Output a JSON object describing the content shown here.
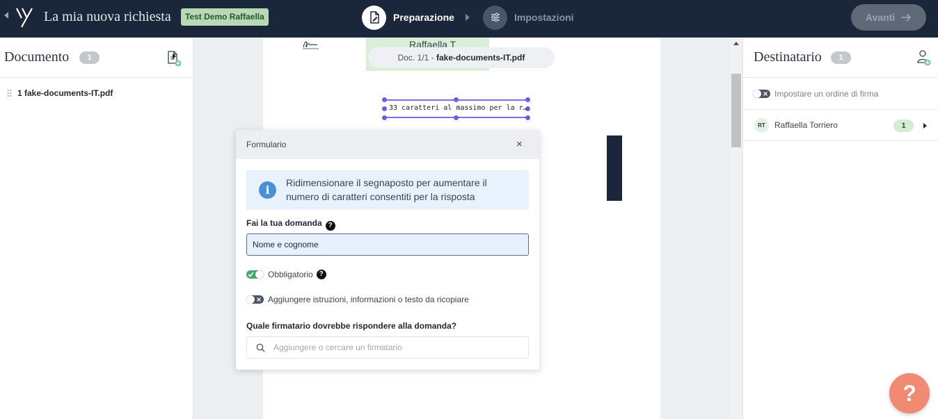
{
  "topbar": {
    "app_title": "La mia nuova richiesta",
    "demo_badge": "Test Demo Raffaella",
    "steps": [
      {
        "label": "Preparazione",
        "icon": "document-edit-icon",
        "active": true
      },
      {
        "label": "Impostazioni",
        "icon": "sliders-icon",
        "active": false
      }
    ],
    "next_button": "Avanti"
  },
  "left_panel": {
    "title": "Documento",
    "count": "1",
    "documents": [
      {
        "label": "1 fake-documents-IT.pdf"
      }
    ]
  },
  "viewer": {
    "signature_name": "Raffaella T",
    "doc_indicator_prefix": "Doc. 1/1 - ",
    "doc_indicator_name": "fake-documents-IT.pdf",
    "text_field_preview": "33 caratteri al massimo per la r…"
  },
  "modal": {
    "title": "Formulario",
    "close": "×",
    "info_text": "Ridimensionare il segnaposto per aumentare il numero di caratteri consentiti per la risposta",
    "question_label": "Fai la tua domanda",
    "question_value": "Nome e cognome",
    "required_label": "Obbligatorio",
    "required_on": true,
    "instructions_label": "Aggiungere istruzioni, informazioni o testo da ricopiare",
    "instructions_on": false,
    "signer_label": "Quale firmatario dovrebbe rispondere alla domanda?",
    "signer_placeholder": "Aggiungere o cercare un firmatario"
  },
  "right_panel": {
    "title": "Destinatario",
    "count": "1",
    "sign_order_label": "Impostare un ordine di firma",
    "sign_order_on": false,
    "recipients": [
      {
        "initials": "RT",
        "name": "Raffaella Torriero",
        "order": "1"
      }
    ]
  },
  "help_button": "?",
  "colors": {
    "topbar_bg": "#1a2639",
    "badge_green": "#b9d8b5",
    "accent_purple": "#6d5edb",
    "toggle_on": "#45a96a",
    "info_bg": "#e7f2fc",
    "help_fab": "#f08a72"
  }
}
